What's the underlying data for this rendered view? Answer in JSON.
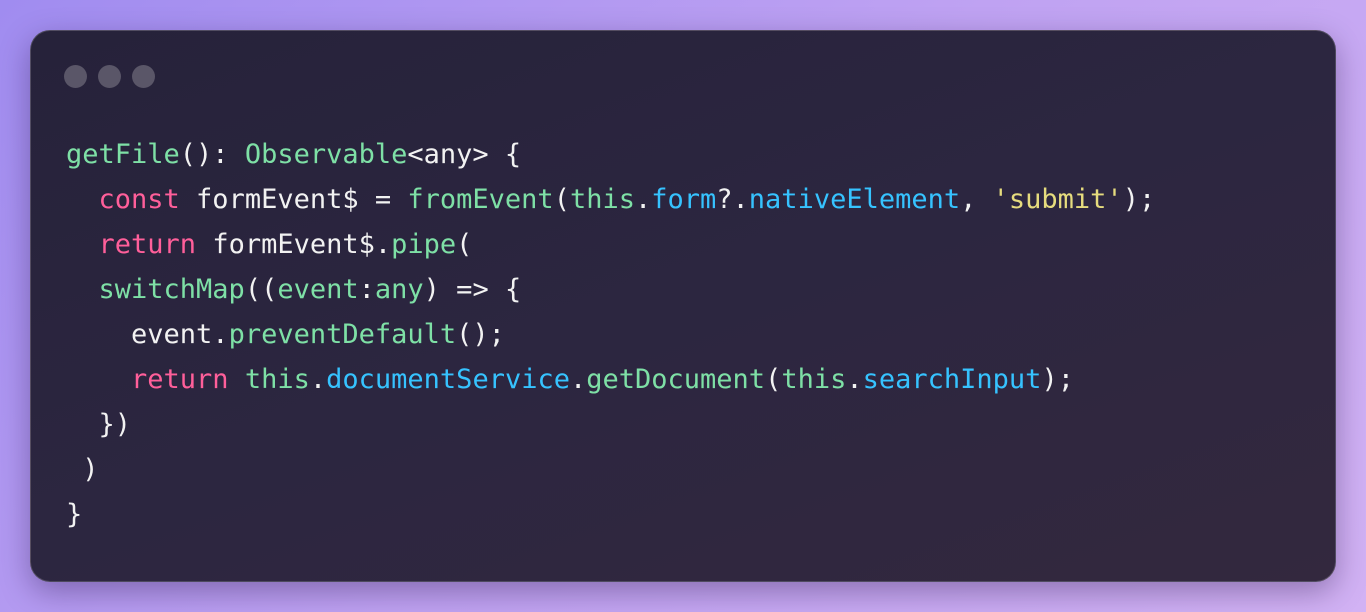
{
  "window": {
    "controls": [
      "dot-1",
      "dot-2",
      "dot-3"
    ]
  },
  "code": {
    "colors": {
      "plain": "#f2f2f2",
      "fn": "#7ee0a6",
      "kw": "#ff5f9a",
      "prop": "#36c3ff",
      "str": "#e6dc7e"
    },
    "lines": [
      [
        {
          "t": "getFile",
          "c": "fn"
        },
        {
          "t": "(): ",
          "c": "plain"
        },
        {
          "t": "Observable",
          "c": "fn"
        },
        {
          "t": "<any> {",
          "c": "plain"
        }
      ],
      [
        {
          "t": "  ",
          "c": "plain"
        },
        {
          "t": "const",
          "c": "kw"
        },
        {
          "t": " formEvent$ = ",
          "c": "plain"
        },
        {
          "t": "fromEvent",
          "c": "fn"
        },
        {
          "t": "(",
          "c": "plain"
        },
        {
          "t": "this",
          "c": "fn"
        },
        {
          "t": ".",
          "c": "plain"
        },
        {
          "t": "form",
          "c": "prop"
        },
        {
          "t": "?.",
          "c": "plain"
        },
        {
          "t": "nativeElement",
          "c": "prop"
        },
        {
          "t": ", ",
          "c": "plain"
        },
        {
          "t": "'submit'",
          "c": "str"
        },
        {
          "t": ");",
          "c": "plain"
        }
      ],
      [
        {
          "t": "  ",
          "c": "plain"
        },
        {
          "t": "return",
          "c": "kw"
        },
        {
          "t": " formEvent$.",
          "c": "plain"
        },
        {
          "t": "pipe",
          "c": "fn"
        },
        {
          "t": "(",
          "c": "plain"
        }
      ],
      [
        {
          "t": "  ",
          "c": "plain"
        },
        {
          "t": "switchMap",
          "c": "fn"
        },
        {
          "t": "((",
          "c": "plain"
        },
        {
          "t": "event",
          "c": "fn"
        },
        {
          "t": ":",
          "c": "plain"
        },
        {
          "t": "any",
          "c": "fn"
        },
        {
          "t": ") => {",
          "c": "plain"
        }
      ],
      [
        {
          "t": "    event.",
          "c": "plain"
        },
        {
          "t": "preventDefault",
          "c": "fn"
        },
        {
          "t": "();",
          "c": "plain"
        }
      ],
      [
        {
          "t": "    ",
          "c": "plain"
        },
        {
          "t": "return",
          "c": "kw"
        },
        {
          "t": " ",
          "c": "plain"
        },
        {
          "t": "this",
          "c": "fn"
        },
        {
          "t": ".",
          "c": "plain"
        },
        {
          "t": "documentService",
          "c": "prop"
        },
        {
          "t": ".",
          "c": "plain"
        },
        {
          "t": "getDocument",
          "c": "fn"
        },
        {
          "t": "(",
          "c": "plain"
        },
        {
          "t": "this",
          "c": "fn"
        },
        {
          "t": ".",
          "c": "plain"
        },
        {
          "t": "searchInput",
          "c": "prop"
        },
        {
          "t": ");",
          "c": "plain"
        }
      ],
      [
        {
          "t": "  })",
          "c": "plain"
        }
      ],
      [
        {
          "t": " )",
          "c": "plain"
        }
      ],
      [
        {
          "t": "}",
          "c": "plain"
        }
      ]
    ]
  }
}
